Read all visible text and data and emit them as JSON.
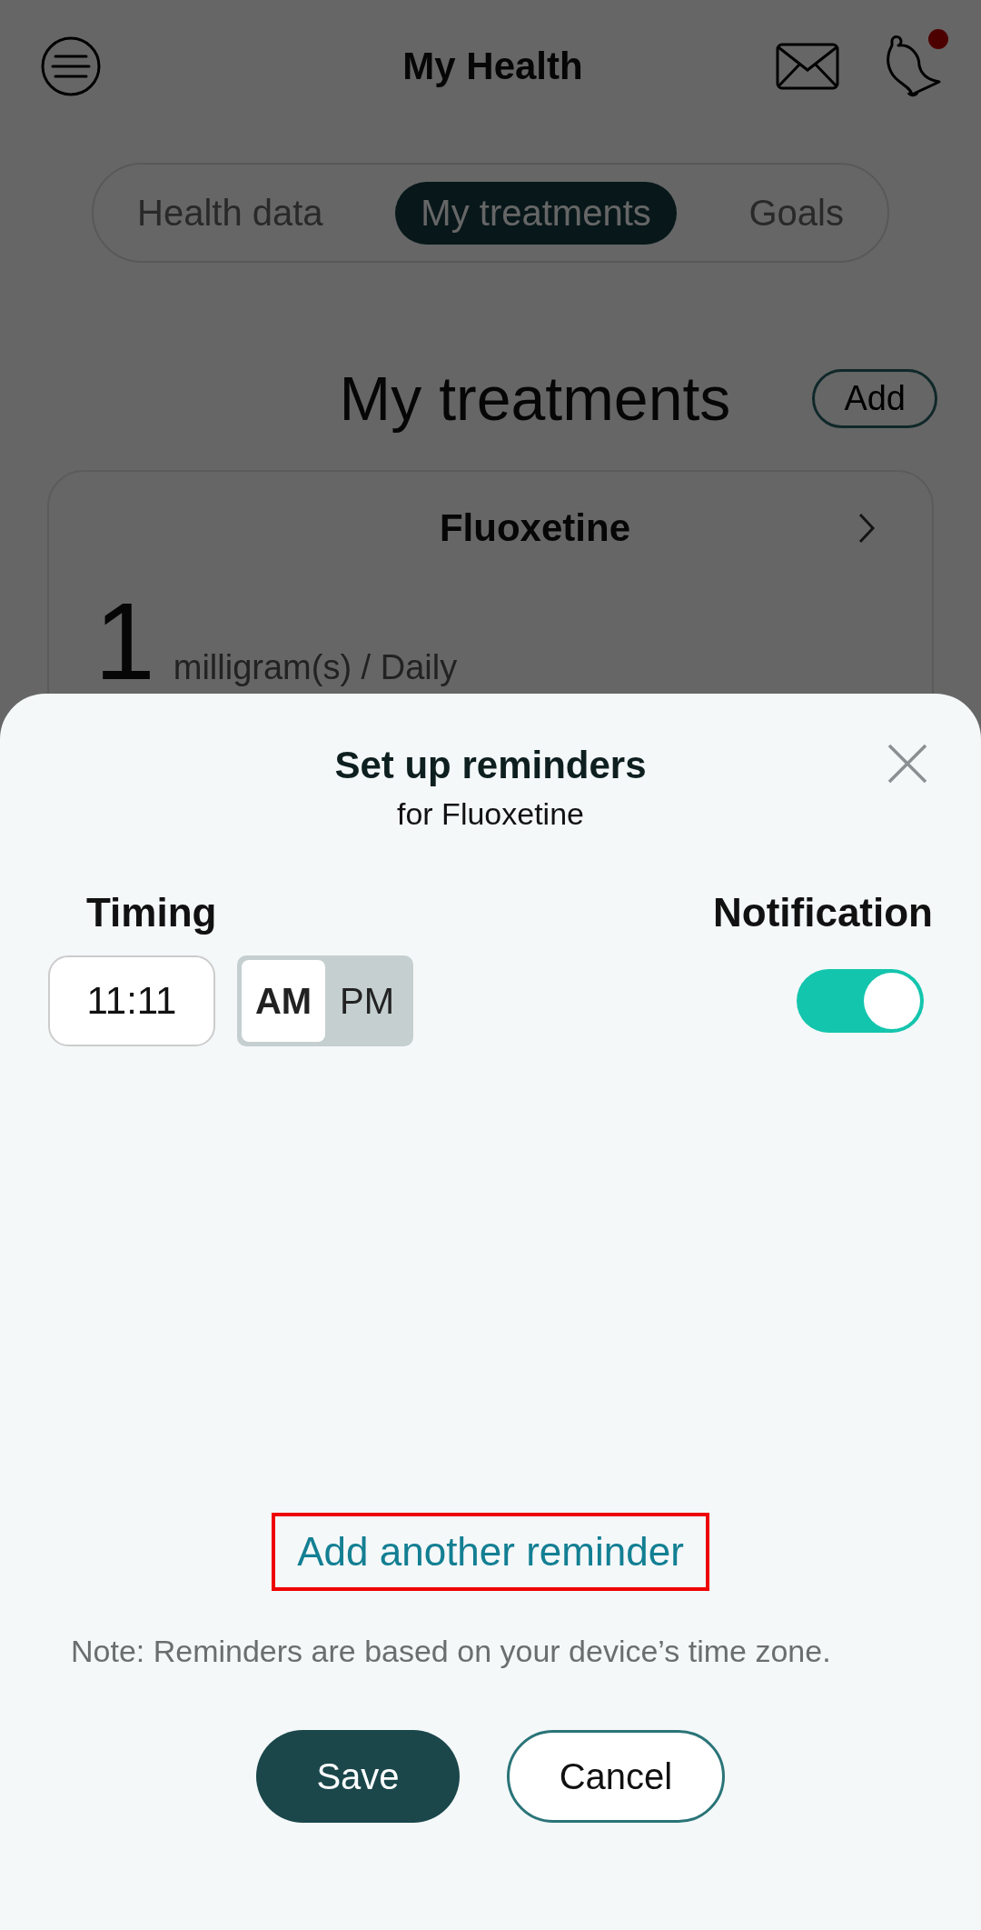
{
  "header": {
    "title": "My Health",
    "unread": true
  },
  "tabs": [
    {
      "label": "Health data",
      "selected": false
    },
    {
      "label": "My treatments",
      "selected": true
    },
    {
      "label": "Goals",
      "selected": false
    }
  ],
  "section": {
    "title": "My treatments",
    "add_button": "Add"
  },
  "treatment_card": {
    "name": "Fluoxetine",
    "dose": "1",
    "unit": "milligram(s) / Daily"
  },
  "reminder_sheet": {
    "title": "Set up reminders",
    "subtitle": "for Fluoxetine",
    "timing_label": "Timing",
    "notification_label": "Notification",
    "reminders": [
      {
        "time": "11:11",
        "periods": [
          {
            "label": "AM",
            "selected": true
          },
          {
            "label": "PM",
            "selected": false
          }
        ],
        "notification_on": true
      }
    ],
    "add_link": {
      "label": "Add another reminder",
      "highlighted": true
    },
    "note": "Note: Reminders are based on your device’s time zone.",
    "buttons": [
      {
        "label": "Save",
        "kind": "primary"
      },
      {
        "label": "Cancel",
        "kind": "secondary"
      }
    ]
  }
}
